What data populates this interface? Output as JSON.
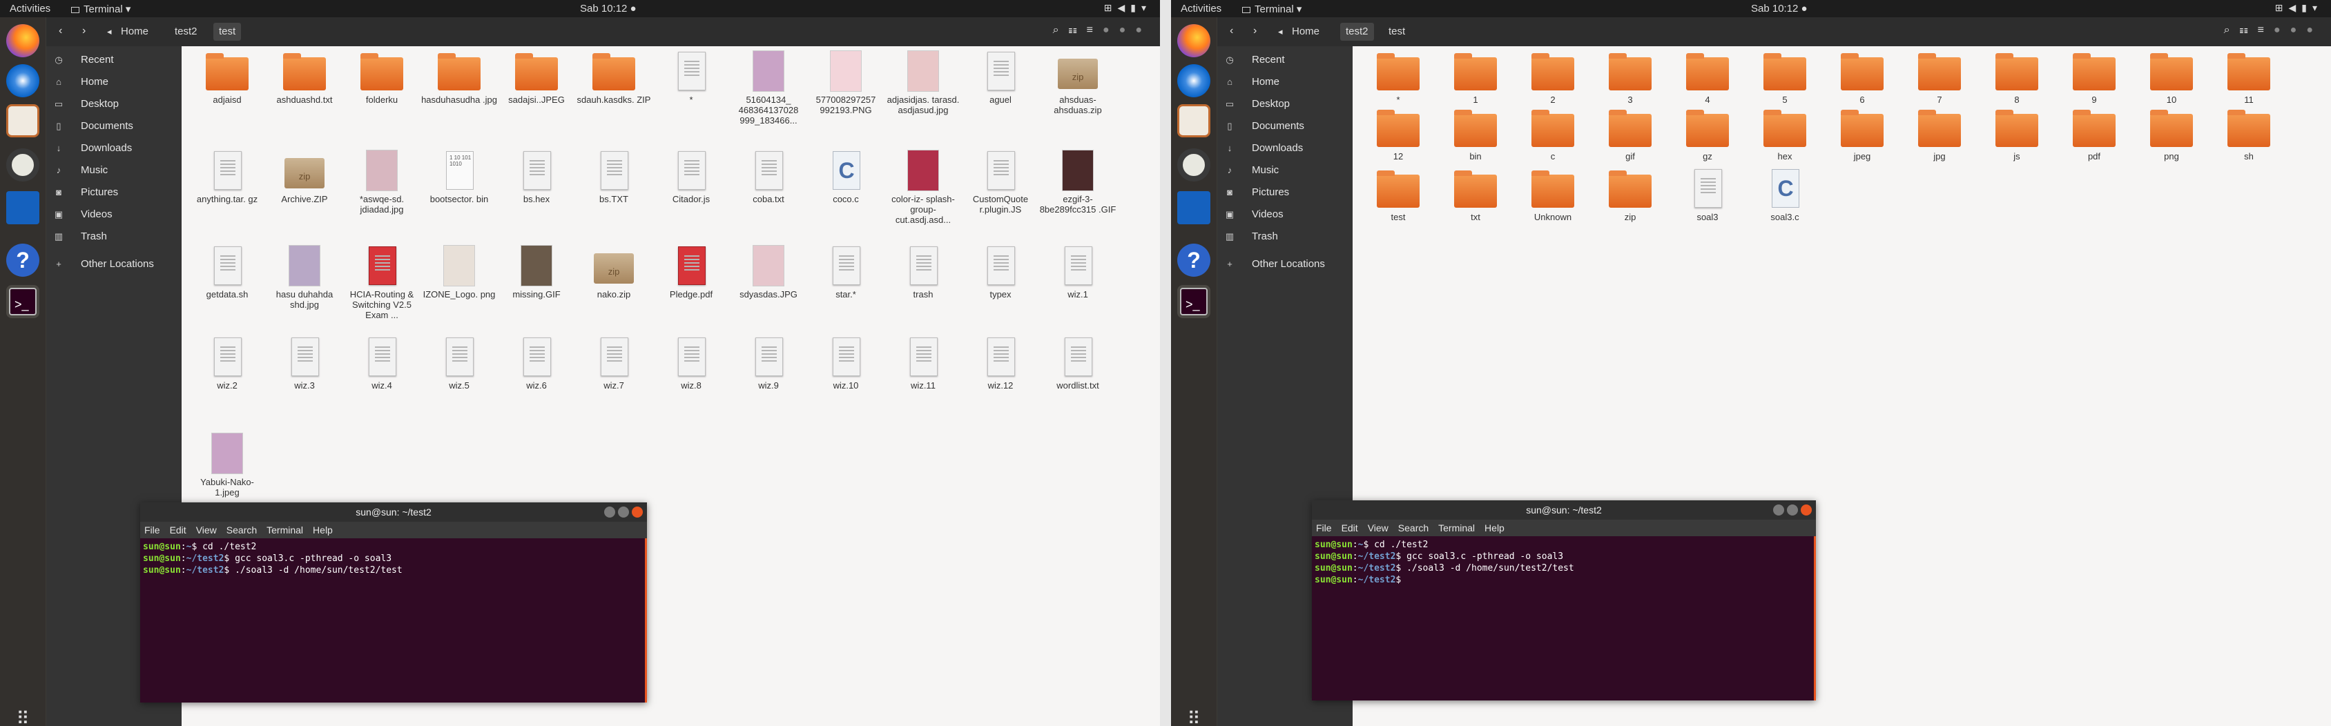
{
  "topbar": {
    "activities": "Activities",
    "app": "Terminal ▾",
    "clock": "Sab 10:12 ●"
  },
  "colors": {
    "terminal_bg": "#300a24",
    "accent": "#e95420",
    "prompt_user": "#8ae234",
    "prompt_path": "#729fcf"
  },
  "sidebar": [
    {
      "icon": "clock-icon",
      "label": "Recent"
    },
    {
      "icon": "home-icon",
      "label": "Home"
    },
    {
      "icon": "desktop-icon",
      "label": "Desktop"
    },
    {
      "icon": "document-icon",
      "label": "Documents"
    },
    {
      "icon": "download-icon",
      "label": "Downloads"
    },
    {
      "icon": "music-icon",
      "label": "Music"
    },
    {
      "icon": "camera-icon",
      "label": "Pictures"
    },
    {
      "icon": "video-icon",
      "label": "Videos"
    },
    {
      "icon": "trash-icon",
      "label": "Trash"
    },
    {
      "icon": "plus-icon",
      "label": "Other Locations"
    }
  ],
  "menu": [
    "File",
    "Edit",
    "View",
    "Search",
    "Terminal",
    "Help"
  ],
  "left": {
    "breadcrumb": [
      "Home",
      "test2",
      "test"
    ],
    "files": [
      {
        "name": "adjaisd",
        "type": "folder"
      },
      {
        "name": "ashduashd.txt",
        "type": "folder"
      },
      {
        "name": "folderku",
        "type": "folder"
      },
      {
        "name": "hasduhasudha .jpg",
        "type": "folder"
      },
      {
        "name": "sadajsi..JPEG",
        "type": "folder"
      },
      {
        "name": "sdauh.kasdks. ZIP",
        "type": "folder"
      },
      {
        "name": "*",
        "type": "doc"
      },
      {
        "name": "51604134_ 468364137028 999_183466...",
        "type": "image"
      },
      {
        "name": "577008297257 992193.PNG",
        "type": "image"
      },
      {
        "name": "adjasidjas. tarasd. asdjasud.jpg",
        "type": "image"
      },
      {
        "name": "aguel",
        "type": "doc"
      },
      {
        "name": "ahsduas- ahsduas.zip",
        "type": "zip"
      },
      {
        "name": "anything.tar. gz",
        "type": "doc"
      },
      {
        "name": "Archive.ZIP",
        "type": "zip"
      },
      {
        "name": "*aswqe-sd. jdiadad.jpg",
        "type": "image"
      },
      {
        "name": "bootsector. bin",
        "type": "bin"
      },
      {
        "name": "bs.hex",
        "type": "doc"
      },
      {
        "name": "bs.TXT",
        "type": "doc"
      },
      {
        "name": "Citador.js",
        "type": "doc"
      },
      {
        "name": "coba.txt",
        "type": "doc"
      },
      {
        "name": "coco.c",
        "type": "c"
      },
      {
        "name": "color-iz- splash-group- cut.asdj.asd...",
        "type": "image"
      },
      {
        "name": "CustomQuote r.plugin.JS",
        "type": "doc"
      },
      {
        "name": "ezgif-3- 8be289fcc315 .GIF",
        "type": "image"
      },
      {
        "name": "getdata.sh",
        "type": "doc"
      },
      {
        "name": "hasu duhahda shd.jpg",
        "type": "image"
      },
      {
        "name": "HCIA-Routing & Switching V2.5 Exam ...",
        "type": "pdf"
      },
      {
        "name": "IZONE_Logo. png",
        "type": "image"
      },
      {
        "name": "missing.GIF",
        "type": "image"
      },
      {
        "name": "nako.zip",
        "type": "zip"
      },
      {
        "name": "Pledge.pdf",
        "type": "pdf"
      },
      {
        "name": "sdyasdas.JPG",
        "type": "image"
      },
      {
        "name": "star.*",
        "type": "doc"
      },
      {
        "name": "trash",
        "type": "doc"
      },
      {
        "name": "typex",
        "type": "doc"
      },
      {
        "name": "wiz.1",
        "type": "doc"
      },
      {
        "name": "wiz.2",
        "type": "doc"
      },
      {
        "name": "wiz.3",
        "type": "doc"
      },
      {
        "name": "wiz.4",
        "type": "doc"
      },
      {
        "name": "wiz.5",
        "type": "doc"
      },
      {
        "name": "wiz.6",
        "type": "doc"
      },
      {
        "name": "wiz.7",
        "type": "doc"
      },
      {
        "name": "wiz.8",
        "type": "doc"
      },
      {
        "name": "wiz.9",
        "type": "doc"
      },
      {
        "name": "wiz.10",
        "type": "doc"
      },
      {
        "name": "wiz.11",
        "type": "doc"
      },
      {
        "name": "wiz.12",
        "type": "doc"
      },
      {
        "name": "wordlist.txt",
        "type": "doc"
      },
      {
        "name": "Yabuki-Nako- 1.jpeg",
        "type": "image"
      }
    ],
    "terminal": {
      "title": "sun@sun: ~/test2",
      "lines": [
        {
          "user": "sun@sun",
          "path": "~",
          "cmd": "$ cd ./test2"
        },
        {
          "user": "sun@sun",
          "path": "~/test2",
          "cmd": "$ gcc soal3.c -pthread -o soal3"
        },
        {
          "user": "sun@sun",
          "path": "~/test2",
          "cmd": "$ ./soal3 -d /home/sun/test2/test"
        }
      ]
    }
  },
  "right": {
    "breadcrumb": [
      "Home",
      "test2",
      "test"
    ],
    "files": [
      {
        "name": "*",
        "type": "folder"
      },
      {
        "name": "1",
        "type": "folder"
      },
      {
        "name": "2",
        "type": "folder"
      },
      {
        "name": "3",
        "type": "folder"
      },
      {
        "name": "4",
        "type": "folder"
      },
      {
        "name": "5",
        "type": "folder"
      },
      {
        "name": "6",
        "type": "folder"
      },
      {
        "name": "7",
        "type": "folder"
      },
      {
        "name": "8",
        "type": "folder"
      },
      {
        "name": "9",
        "type": "folder"
      },
      {
        "name": "10",
        "type": "folder"
      },
      {
        "name": "11",
        "type": "folder"
      },
      {
        "name": "12",
        "type": "folder"
      },
      {
        "name": "bin",
        "type": "folder"
      },
      {
        "name": "c",
        "type": "folder"
      },
      {
        "name": "gif",
        "type": "folder"
      },
      {
        "name": "gz",
        "type": "folder"
      },
      {
        "name": "hex",
        "type": "folder"
      },
      {
        "name": "jpeg",
        "type": "folder"
      },
      {
        "name": "jpg",
        "type": "folder"
      },
      {
        "name": "js",
        "type": "folder"
      },
      {
        "name": "pdf",
        "type": "folder"
      },
      {
        "name": "png",
        "type": "folder"
      },
      {
        "name": "sh",
        "type": "folder"
      },
      {
        "name": "test",
        "type": "folder"
      },
      {
        "name": "txt",
        "type": "folder"
      },
      {
        "name": "Unknown",
        "type": "folder"
      },
      {
        "name": "zip",
        "type": "folder"
      },
      {
        "name": "soal3",
        "type": "doc"
      },
      {
        "name": "soal3.c",
        "type": "c"
      }
    ],
    "terminal": {
      "title": "sun@sun: ~/test2",
      "lines": [
        {
          "user": "sun@sun",
          "path": "~",
          "cmd": "$ cd ./test2"
        },
        {
          "user": "sun@sun",
          "path": "~/test2",
          "cmd": "$ gcc soal3.c -pthread -o soal3"
        },
        {
          "user": "sun@sun",
          "path": "~/test2",
          "cmd": "$ ./soal3 -d /home/sun/test2/test"
        },
        {
          "user": "sun@sun",
          "path": "~/test2",
          "cmd": "$"
        }
      ]
    }
  }
}
